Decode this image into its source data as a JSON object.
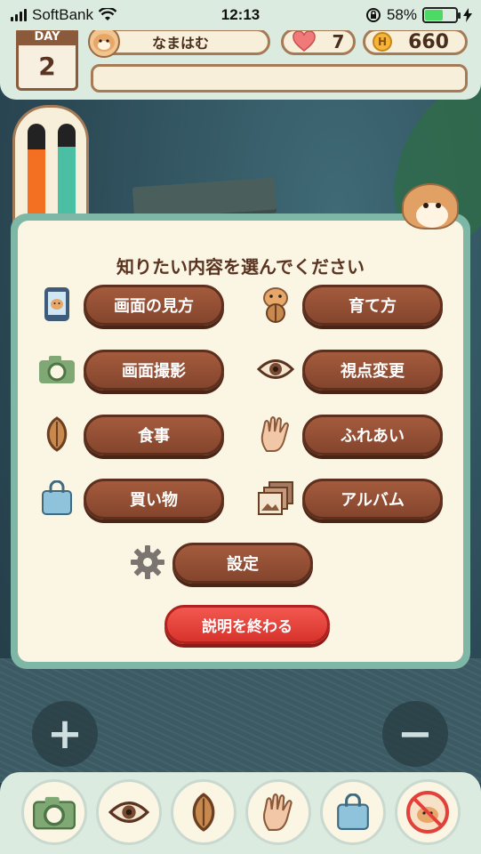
{
  "status_bar": {
    "carrier": "SoftBank",
    "time": "12:13",
    "battery_percent": "58%",
    "battery_level": 0.58
  },
  "hud": {
    "day_label": "DAY",
    "day_number": "2",
    "hamster_name": "なまはむ",
    "hearts": "7",
    "coin_symbol": "H",
    "coins": "660",
    "message": ""
  },
  "thermometer": {
    "left_level": 0.72,
    "right_level": 0.75,
    "left_color": "#f36f21",
    "right_color": "#4bbfa3"
  },
  "panel": {
    "title": "知りたい内容を選んでください",
    "options": [
      {
        "label": "画面の見方",
        "icon": "phone-hamster-icon"
      },
      {
        "label": "育て方",
        "icon": "hamster-sunflower-seed-icon"
      },
      {
        "label": "画面撮影",
        "icon": "camera-icon"
      },
      {
        "label": "視点変更",
        "icon": "eye-icon"
      },
      {
        "label": "食事",
        "icon": "sunflower-seed-icon"
      },
      {
        "label": "ふれあい",
        "icon": "hand-icon"
      },
      {
        "label": "買い物",
        "icon": "shopping-bag-icon"
      },
      {
        "label": "アルバム",
        "icon": "album-icon"
      },
      {
        "label": "設定",
        "icon": "gear-icon"
      }
    ],
    "end_label": "説明を終わる"
  },
  "zoom": {
    "in_label": "+",
    "out_label": "−"
  },
  "toolbar": [
    "camera-icon",
    "eye-icon",
    "sunflower-seed-icon",
    "hand-icon",
    "shopping-bag-icon",
    "hamster-cancel-icon"
  ],
  "colors": {
    "accent_brown": "#8a4a30",
    "end_red": "#e2403a",
    "panel_green": "#7fb7a6",
    "cream": "#fbf5e4"
  }
}
